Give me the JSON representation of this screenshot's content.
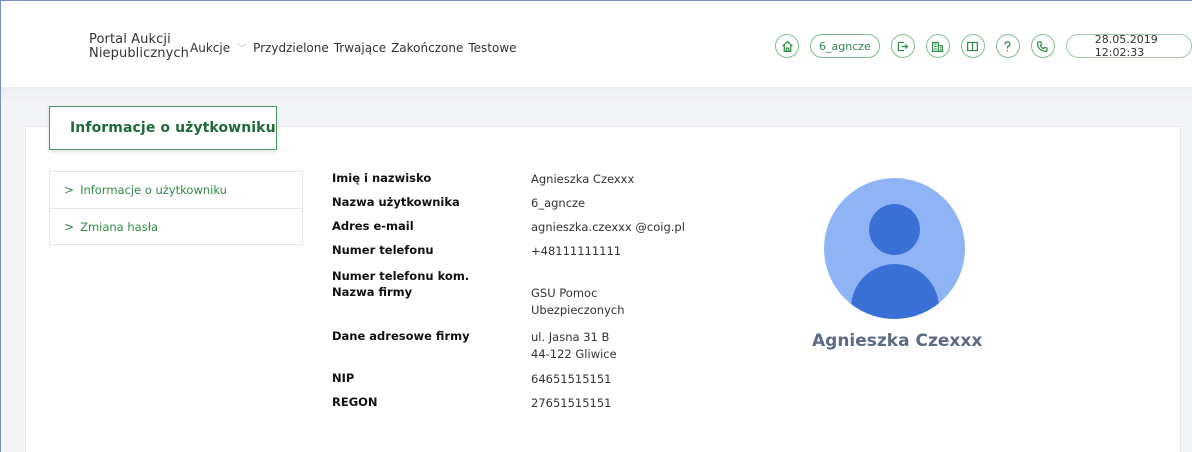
{
  "header": {
    "brand_line1": "Portal Aukcji",
    "brand_line2": "Niepublicznych",
    "nav": [
      {
        "label": "Aukcje"
      },
      {
        "label": "Przydzielone"
      },
      {
        "label": "Trwające"
      },
      {
        "label": "Zakończone"
      },
      {
        "label": "Testowe"
      }
    ],
    "username_pill": "6_agncze",
    "datetime": "28.05.2019 12:02:33",
    "icons": [
      "home-icon",
      "logout-icon",
      "buildings-icon",
      "book-icon",
      "help-icon",
      "phone-icon"
    ]
  },
  "page": {
    "title": "Informacje o użytkowniku"
  },
  "sidebar": {
    "items": [
      {
        "label": "Informacje o użytkowniku"
      },
      {
        "label": "Zmiana hasła"
      }
    ]
  },
  "details": {
    "full_name_label": "Imię i nazwisko",
    "full_name": "Agnieszka Czexxx",
    "username_label": "Nazwa użytkownika",
    "username": "6_agncze",
    "email_label": "Adres e-mail",
    "email": "agnieszka.czexxx @coig.pl",
    "phone_label": "Numer telefonu",
    "phone": "+48111111111",
    "mobile_label": "Numer telefonu kom.",
    "mobile": "",
    "company_label": "Nazwa firmy",
    "company_line1": "GSU Pomoc",
    "company_line2": "Ubezpieczonych",
    "address_label": "Dane adresowe firmy",
    "address_line1": "ul. Jasna 31 B",
    "address_line2": "44-122 Gliwice",
    "nip_label": "NIP",
    "nip": "64651515151",
    "regon_label": "REGON",
    "regon": "27651515151"
  },
  "profile": {
    "display_name": "Agnieszka Czexxx"
  },
  "colors": {
    "accent": "#2e8b45",
    "avatar_bg": "#8fb4f5",
    "avatar_fg": "#3b71d6"
  }
}
